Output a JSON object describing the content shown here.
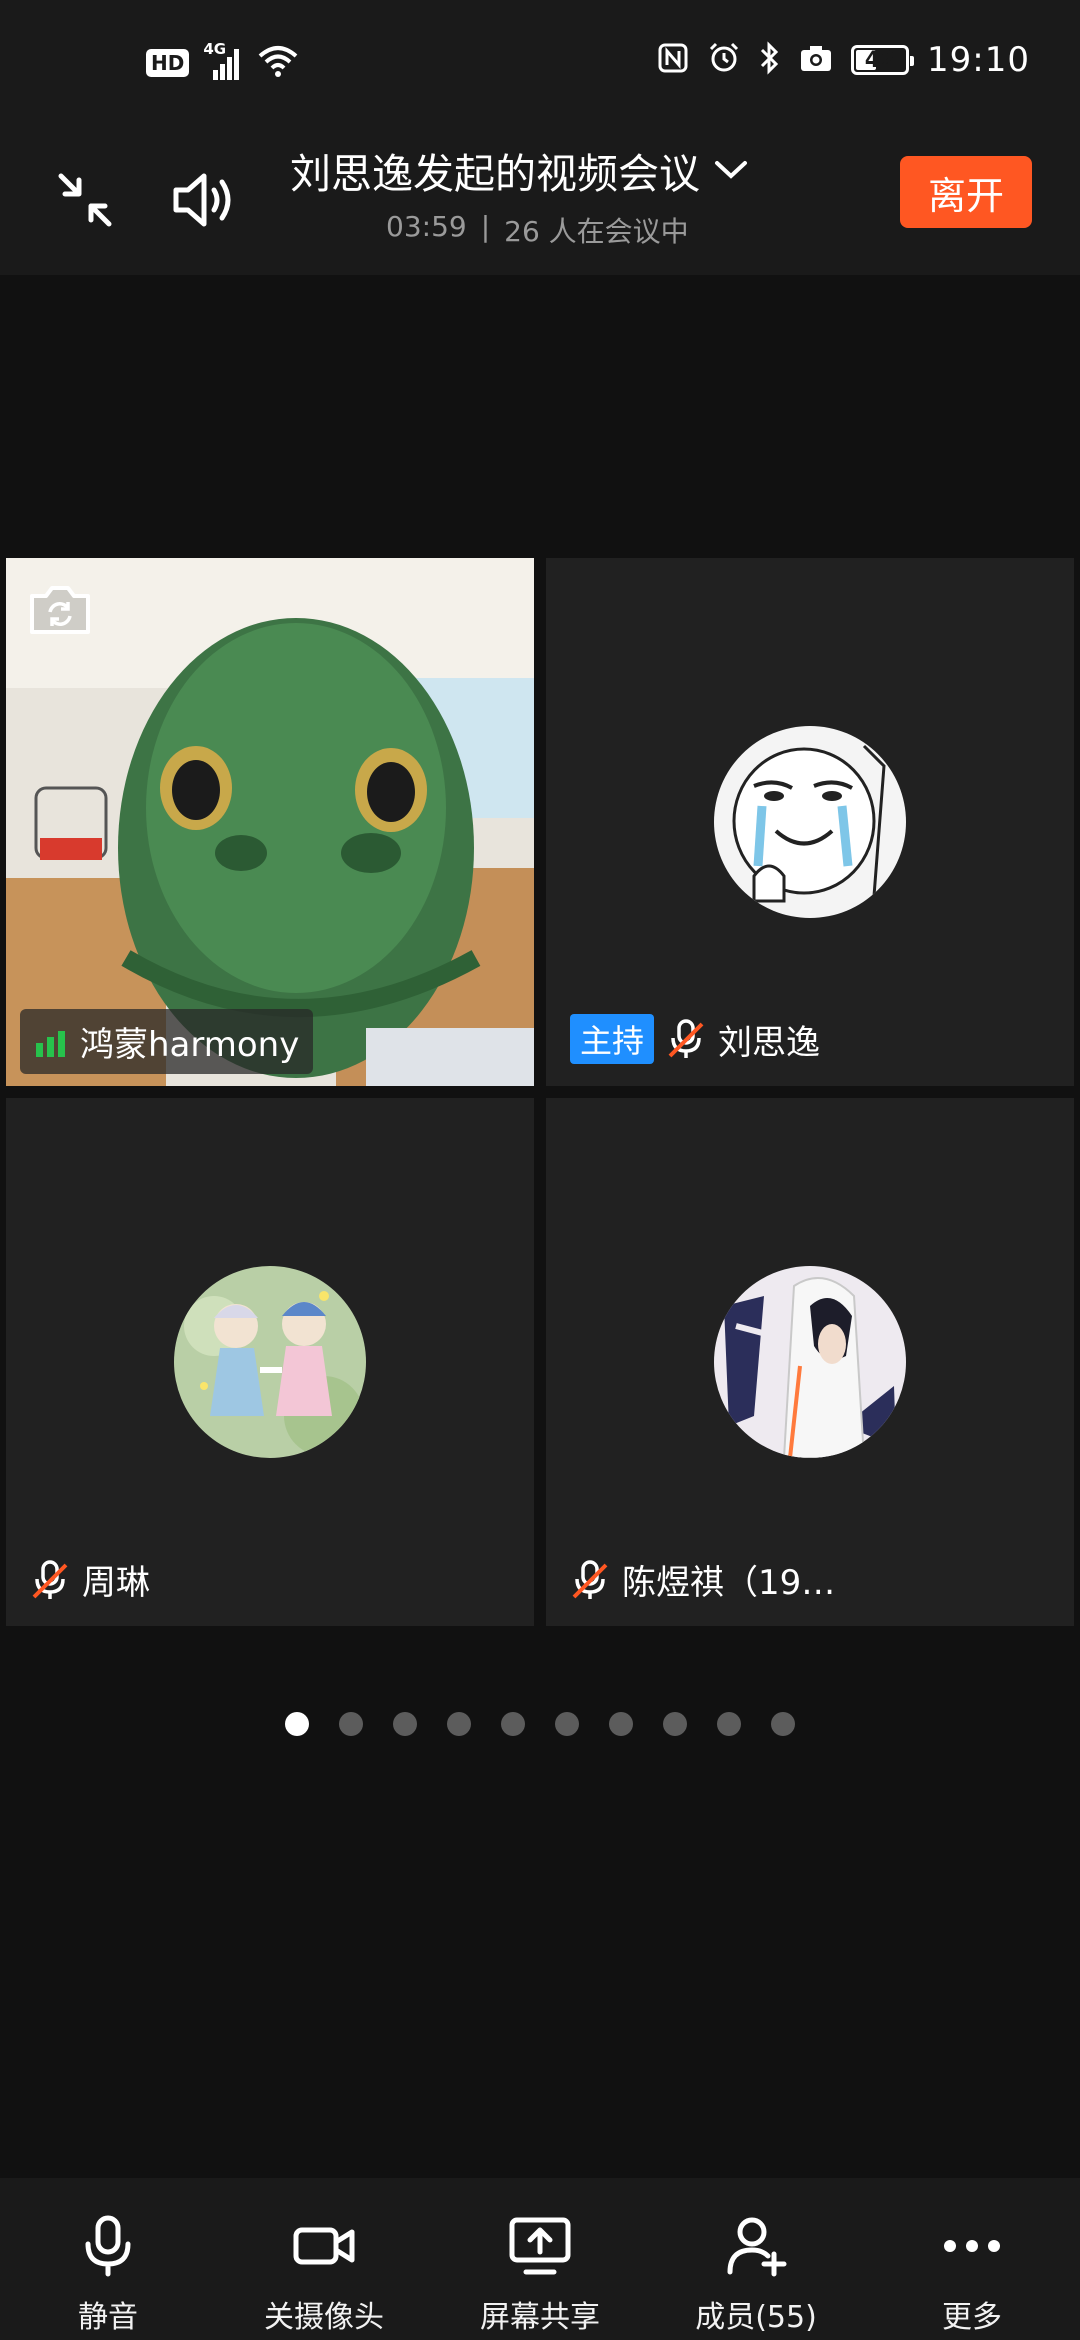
{
  "status_bar": {
    "hd": "HD",
    "network": "4G",
    "battery": "42",
    "battery_level": 0.42,
    "time": "19:10"
  },
  "header": {
    "title": "刘思逸发起的视频会议",
    "duration": "03:59",
    "separator": "|",
    "participants": "26 人在会议中",
    "leave_label": "离开"
  },
  "tiles": [
    {
      "name": "鸿蒙harmony",
      "muted": false,
      "video": true
    },
    {
      "badge": "主持",
      "name": "刘思逸",
      "muted": true
    },
    {
      "name": "周琳",
      "muted": true
    },
    {
      "name": "陈煜祺（19…",
      "muted": true
    }
  ],
  "pager": {
    "pages": 10,
    "current": 1
  },
  "toolbar": {
    "mute_label": "静音",
    "camera_label": "关摄像头",
    "share_label": "屏幕共享",
    "members_label": "成员(55)",
    "more_label": "更多"
  },
  "colors": {
    "accent": "#ff5722",
    "host_badge": "#1f8fff",
    "signal": "#27c24c",
    "muted": "#ff5722"
  }
}
